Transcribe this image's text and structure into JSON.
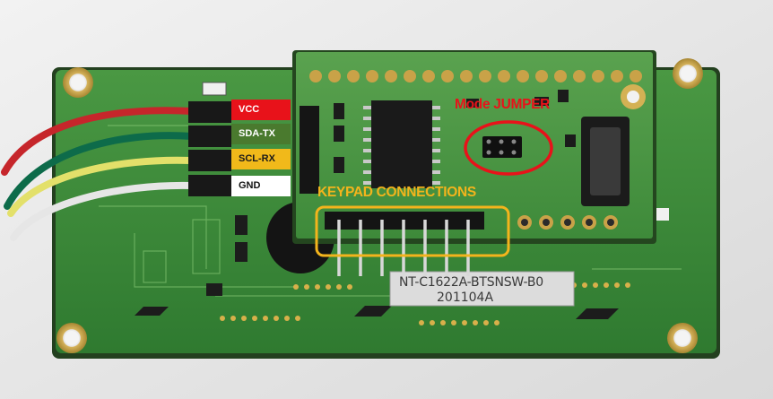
{
  "wire_labels": {
    "vcc": "VCC",
    "sda_tx": "SDA-TX",
    "scl_rx": "SCL-RX",
    "gnd": "GND"
  },
  "annotations": {
    "keypad_connections": "KEYPAD CONNECTIONS",
    "mode_jumper": "Mode JUMPER"
  },
  "board_markings": {
    "part_number": "NT-C1622A-BTSNSW-B0",
    "date_code": "201104A"
  },
  "colors": {
    "vcc": "#e8121a",
    "sda_tx": "#4a7a2e",
    "scl_rx": "#f1b91a",
    "gnd": "#ffffff",
    "keypad_highlight": "#f3b41c",
    "jumper_highlight": "#e8121a",
    "pcb_green": "#3f8a3a"
  }
}
